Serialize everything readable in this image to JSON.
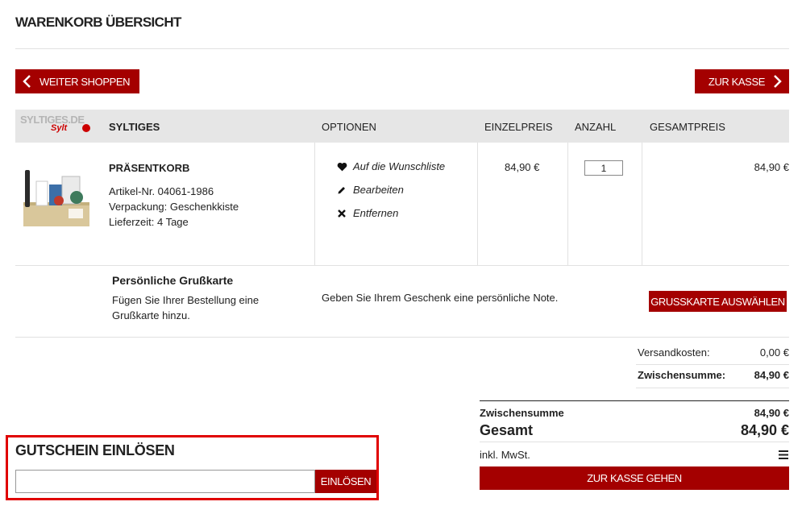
{
  "page": {
    "title": "WARENKORB ÜBERSICHT"
  },
  "nav": {
    "continue_label": "WEITER SHOPPEN",
    "checkout_label": "ZUR KASSE"
  },
  "table": {
    "logo_text": "SYLTIGES.DE",
    "logo_sub": "Sylt",
    "headers": {
      "shop": "SYLTIGES",
      "options": "OPTIONEN",
      "unit_price": "EINZELPREIS",
      "quantity": "ANZAHL",
      "total": "GESAMTPREIS"
    }
  },
  "item": {
    "name": "PRÄSENTKORB",
    "article": "Artikel-Nr. 04061-1986",
    "packaging": "Verpackung: Geschenkkiste",
    "delivery": "Lieferzeit: 4 Tage",
    "options": [
      "Auf die Wunschliste",
      "Bearbeiten",
      "Entfernen"
    ],
    "option_icons": [
      "heart-icon",
      "pencil-icon",
      "close-icon"
    ],
    "unit_price": "84,90 €",
    "quantity": "1",
    "total": "84,90 €"
  },
  "greeting": {
    "title": "Persönliche Grußkarte",
    "desc_line1": "Fügen Sie Ihrer Bestellung eine",
    "desc_line2": "Grußkarte hinzu.",
    "note": "Geben Sie Ihrem Geschenk eine persönliche Note.",
    "button": "GRUSSKARTE AUSWÄHLEN"
  },
  "subtotals": {
    "shipping_label": "Versandkosten:",
    "shipping_value": "0,00 €",
    "subtotal_label": "Zwischensumme:",
    "subtotal_value": "84,90 €"
  },
  "voucher": {
    "title": "GUTSCHEIN EINLÖSEN",
    "input_value": "",
    "button": "EINLÖSEN"
  },
  "totals": {
    "subtotal_label": "Zwischensumme",
    "subtotal_value": "84,90 €",
    "total_label": "Gesamt",
    "total_value": "84,90 €",
    "vat_label": "inkl. MwSt.",
    "checkout_button": "ZUR KASSE GEHEN"
  },
  "colors": {
    "accent": "#a40000",
    "highlight_border": "#e00000",
    "header_bg": "#e6e6e6"
  }
}
